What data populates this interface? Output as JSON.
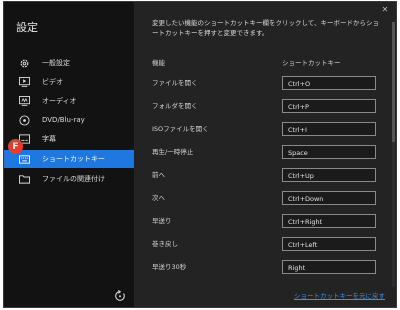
{
  "sidebar": {
    "title": "設定",
    "items": [
      {
        "label": "一般設定",
        "icon": "gear-icon"
      },
      {
        "label": "ビデオ",
        "icon": "video-icon"
      },
      {
        "label": "オーディオ",
        "icon": "audio-icon"
      },
      {
        "label": "DVD/Blu-ray",
        "icon": "disc-icon"
      },
      {
        "label": "字幕",
        "icon": "subtitle-icon"
      },
      {
        "label": "ショートカットキー",
        "icon": "keyboard-icon",
        "active": true
      },
      {
        "label": "ファイルの関連付け",
        "icon": "folder-icon"
      }
    ],
    "badge": "F"
  },
  "main": {
    "description": "変更したい機能のショートカットキー欄をクリックして、キーボードからショートカットキーを押すと変更できます。",
    "col_function": "機能",
    "col_shortcut": "ショートカットキー",
    "rows": [
      {
        "function": "ファイルを開く",
        "key": "Ctrl+O"
      },
      {
        "function": "フォルダを開く",
        "key": "Ctrl+P"
      },
      {
        "function": "ISOファイルを開く",
        "key": "Ctrl+I"
      },
      {
        "function": "再生/一時停止",
        "key": "Space"
      },
      {
        "function": "前へ",
        "key": "Ctrl+Up"
      },
      {
        "function": "次へ",
        "key": "Ctrl+Down"
      },
      {
        "function": "早送り",
        "key": "Ctrl+Right"
      },
      {
        "function": "巻き戻し",
        "key": "Ctrl+Left"
      },
      {
        "function": "早送り30秒",
        "key": "Right"
      }
    ],
    "restore_link": "ショートカットキーを元に戻す"
  },
  "colors": {
    "accent": "#1f78e0",
    "badge": "#e43d30",
    "link": "#3d8fe8"
  }
}
